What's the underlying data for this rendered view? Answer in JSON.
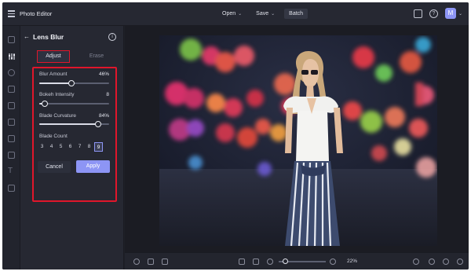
{
  "app": {
    "title": "Photo Editor"
  },
  "toolbar": {
    "open_label": "Open",
    "save_label": "Save",
    "batch_label": "Batch",
    "avatar_initial": "M"
  },
  "panel": {
    "title": "Lens Blur",
    "tabs": [
      {
        "label": "Adjust",
        "active": true
      },
      {
        "label": "Erase",
        "active": false
      }
    ],
    "controls": [
      {
        "label": "Blur Amount",
        "value_text": "46%",
        "value": 46,
        "min": 0,
        "max": 100
      },
      {
        "label": "Bokeh Intensity",
        "value_text": "8",
        "value": 8,
        "min": 0,
        "max": 100
      },
      {
        "label": "Blade Curvature",
        "value_text": "84%",
        "value": 84,
        "min": 0,
        "max": 100
      }
    ],
    "blade_count": {
      "label": "Blade Count",
      "options": [
        "3",
        "4",
        "5",
        "6",
        "7",
        "8",
        "9"
      ],
      "selected": "9"
    },
    "cancel_label": "Cancel",
    "apply_label": "Apply"
  },
  "bottom": {
    "zoom_text": "22%"
  },
  "colors": {
    "accent": "#8d95f5",
    "highlight": "#e0162b",
    "background": "#1e2028"
  },
  "icons": [
    "menu-icon",
    "chevron-down-icon",
    "chat-icon",
    "help-icon",
    "back-arrow-icon",
    "info-icon",
    "layers-icon",
    "crop-icon",
    "fit-icon",
    "zoom-out-icon",
    "zoom-in-icon",
    "undo-icon",
    "redo-icon",
    "history-icon"
  ]
}
